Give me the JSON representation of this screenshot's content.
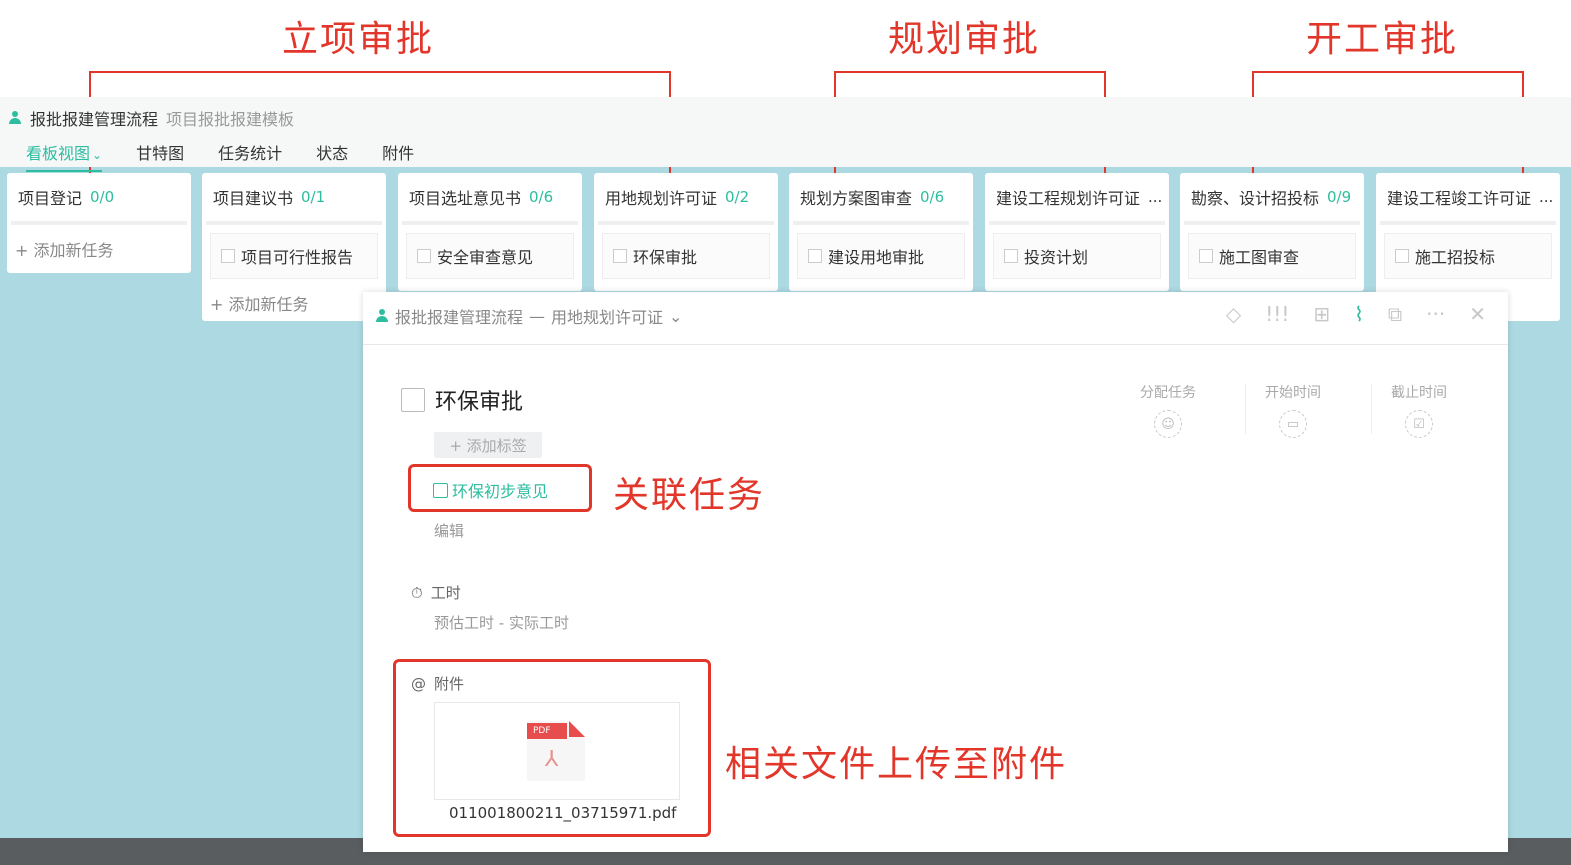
{
  "annotations": {
    "stage_1": "立项审批",
    "stage_2": "规划审批",
    "stage_3": "开工审批",
    "related_task_note": "关联任务",
    "attachment_note": "相关文件上传至附件"
  },
  "header": {
    "project_name": "报批报建管理流程",
    "template_name": "项目报批报建模板"
  },
  "tabs": [
    {
      "label": "看板视图"
    },
    {
      "label": "甘特图"
    },
    {
      "label": "任务统计"
    },
    {
      "label": "状态"
    },
    {
      "label": "附件"
    }
  ],
  "add_task_label": "+ 添加新任务",
  "columns": [
    {
      "title": "项目登记",
      "count": "0/0"
    },
    {
      "title": "项目建议书",
      "count": "0/1",
      "card": "项目可行性报告"
    },
    {
      "title": "项目选址意见书",
      "count": "0/6",
      "card": "安全审查意见"
    },
    {
      "title": "用地规划许可证",
      "count": "0/2",
      "card": "环保审批"
    },
    {
      "title": "规划方案图审查",
      "count": "0/6",
      "card": "建设用地审批"
    },
    {
      "title": "建设工程规划许可证",
      "count": "...",
      "card": "投资计划"
    },
    {
      "title": "勘察、设计招投标",
      "count": "0/9",
      "card": "施工图审查"
    },
    {
      "title": "建设工程竣工许可证",
      "count": "...",
      "card": "施工招投标"
    }
  ],
  "panel": {
    "breadcrumb_project": "报批报建管理流程",
    "breadcrumb_sep": "—",
    "breadcrumb_stage": "用地规划许可证",
    "task_title": "环保审批",
    "add_tag_label": "+ 添加标签",
    "related_task": "环保初步意见",
    "edit_label": "编辑",
    "hours_label": "工时",
    "hours_value": "预估工时 - 实际工时",
    "attachment_label": "附件",
    "file_name": "011001800211_03715971.pdf",
    "file_badge": "PDF",
    "assign_label": "分配任务",
    "start_label": "开始时间",
    "due_label": "截止时间"
  },
  "colors": {
    "accent": "#2dbd9f",
    "annotation_red": "#e2362a",
    "background": "#add9e2"
  }
}
